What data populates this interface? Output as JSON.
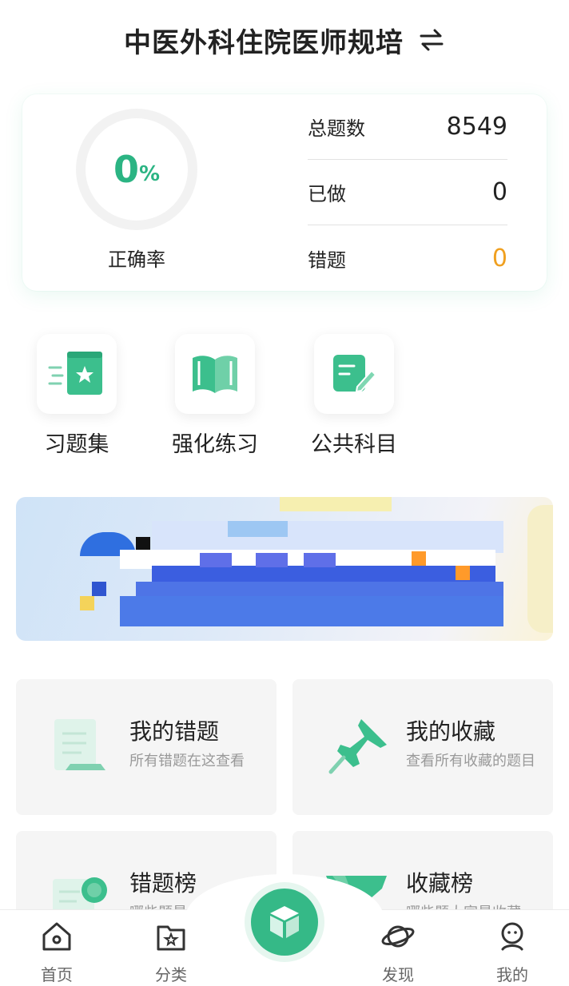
{
  "header": {
    "title": "中医外科住院医师规培",
    "switch_icon": "swap-arrows-icon"
  },
  "stats": {
    "accuracy_value": "0",
    "accuracy_unit": "%",
    "accuracy_fraction": 0,
    "accuracy_label": "正确率",
    "rows": [
      {
        "label": "总题数",
        "value": "8549"
      },
      {
        "label": "已做",
        "value": "0"
      },
      {
        "label": "错题",
        "value": "0"
      }
    ],
    "accent_color": "#2bb483",
    "warn_color": "#f0a020"
  },
  "quick_actions": [
    {
      "label": "习题集",
      "icon": "book-star-icon"
    },
    {
      "label": "强化练习",
      "icon": "open-book-icon"
    },
    {
      "label": "公共科目",
      "icon": "document-edit-icon"
    }
  ],
  "banner": {
    "icon": "banner-image"
  },
  "tiles": [
    {
      "title": "我的错题",
      "desc": "所有错题在这查看",
      "icon": "wrong-note-icon"
    },
    {
      "title": "我的收藏",
      "desc": "查看所有收藏的题目",
      "icon": "pushpin-icon"
    },
    {
      "title": "错题榜",
      "desc": "哪些题最易错",
      "icon": "certificate-icon"
    },
    {
      "title": "收藏榜",
      "desc": "哪些题大家最收藏",
      "icon": "gem-icon"
    }
  ],
  "tabbar": {
    "items": [
      {
        "label": "首页",
        "icon": "home-icon"
      },
      {
        "label": "分类",
        "icon": "folder-star-icon"
      },
      {
        "label": "发现",
        "icon": "planet-icon"
      },
      {
        "label": "我的",
        "icon": "user-icon"
      }
    ],
    "center_icon": "cube-icon"
  }
}
